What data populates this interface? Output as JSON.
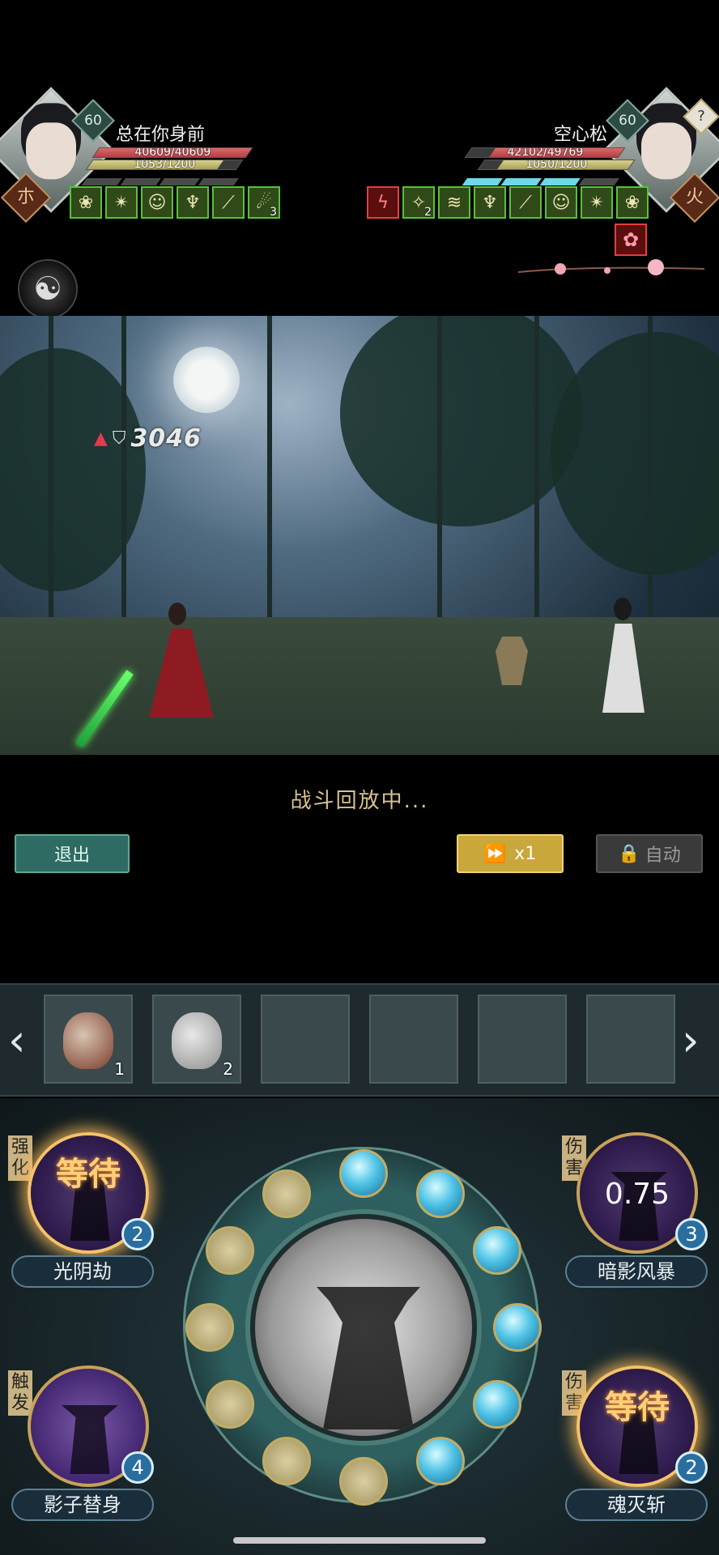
{
  "player_left": {
    "name": "总在你身前",
    "level": "60",
    "hp_text": "40609/40609",
    "hp_fraction": 1.0,
    "mp_text": "1053/1200",
    "mp_fraction": 0.877,
    "sect_icon": "sect-glyph-icon",
    "buffs": [
      {
        "icon": "lotus-icon",
        "count": ""
      },
      {
        "icon": "shuriken-icon",
        "count": ""
      },
      {
        "icon": "figure-icon",
        "count": ""
      },
      {
        "icon": "meditate-icon",
        "count": ""
      },
      {
        "icon": "sword-slash-icon",
        "count": ""
      },
      {
        "icon": "wind-hand-icon",
        "count": "3"
      }
    ]
  },
  "player_right": {
    "name": "空心松",
    "level": "60",
    "hp_text": "42102/49769",
    "hp_fraction": 0.846,
    "mp_text": "1050/1200",
    "mp_fraction": 0.875,
    "help_badge": "?",
    "sect_icon": "flame-sect-icon",
    "buffs": [
      {
        "icon": "lightning-icon",
        "count": ""
      },
      {
        "icon": "sparkle-icon",
        "count": "2"
      },
      {
        "icon": "fire-streak-icon",
        "count": ""
      },
      {
        "icon": "meditate-icon",
        "count": ""
      },
      {
        "icon": "sword-slash-icon",
        "count": ""
      },
      {
        "icon": "figure-icon",
        "count": ""
      },
      {
        "icon": "shuriken-icon",
        "count": ""
      },
      {
        "icon": "lotus-icon",
        "count": ""
      }
    ],
    "extra_buff": "flower-icon"
  },
  "scene": {
    "damage_text": "3046"
  },
  "controls": {
    "replay_status": "战斗回放中...",
    "exit_label": "退出",
    "speed_label": "x1",
    "auto_label": "自动"
  },
  "belt": {
    "slots": [
      {
        "item": "medicine-pot-icon",
        "qty": "1"
      },
      {
        "item": "gourd-bottle-icon",
        "qty": "2"
      },
      {
        "item": "",
        "qty": ""
      },
      {
        "item": "",
        "qty": ""
      },
      {
        "item": "",
        "qty": ""
      },
      {
        "item": "",
        "qty": ""
      }
    ]
  },
  "skills": {
    "top_left": {
      "tag": "强化",
      "name": "光阴劫",
      "state": "等待",
      "count": "2"
    },
    "top_right": {
      "tag": "伤害",
      "name": "暗影风暴",
      "cooldown": "0.75",
      "count": "3"
    },
    "bottom_left": {
      "tag": "触发",
      "name": "影子替身",
      "count": "4"
    },
    "bottom_right": {
      "tag": "伤害",
      "name": "魂灭斩",
      "state": "等待",
      "count": "2"
    },
    "energy_orbs": {
      "filled": 6,
      "total": 12
    }
  },
  "colors": {
    "hp": "#b43f44",
    "mp": "#a9a05a",
    "buff_border": "#56c23a",
    "debuff_border": "#e04040",
    "speed_button": "#c9a73a",
    "exit_button": "#2d6b63"
  }
}
